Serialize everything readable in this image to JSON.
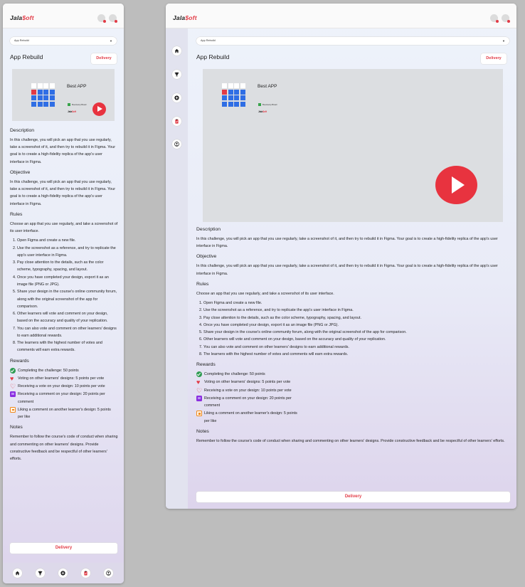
{
  "brand": {
    "logo_main": "Jala",
    "logo_accent": "$oft",
    "accent_color": "#e23a45"
  },
  "header": {
    "icons": [
      "notifications-icon",
      "profile-icon"
    ]
  },
  "select": {
    "value": "App Rebuild"
  },
  "page": {
    "title": "App Rebuild",
    "delivery_button": "Delivery"
  },
  "video": {
    "title": "Best APP",
    "brand_line": "Bootcamp Brasil",
    "brand_logo_main": "Jala",
    "brand_logo_accent": "$oft"
  },
  "sections": {
    "description": {
      "heading": "Description",
      "text": "In this challenge, you will pick an app that you use regularly, take a screenshot of it, and then try to rebuild it in Figma. Your goal is to create a high-fidelity replica of the app's user interface in Figma."
    },
    "objective": {
      "heading": "Objective",
      "text": "In this challenge, you will pick an app that you use regularly, take a screenshot of it, and then try to rebuild it in Figma. Your goal is to create a high-fidelity replica of the app's user interface in Figma."
    },
    "rules": {
      "heading": "Rules",
      "intro": "Choose an app that you use regularly, and take a screenshot of its user interface.",
      "items": [
        "Open Figma and create a new file.",
        "Use the screenshot as a reference, and try to replicate the app's user interface in Figma.",
        "Pay close attention to the details, such as the color scheme, typography, spacing, and layout.",
        "Once you have completed your design, export it as an image file (PNG or JPG).",
        "Share your design in the course's online community forum, along with the original screenshot of the app for comparison.",
        "Other learners will vote and comment on your design, based on the accuracy and quality of your replication.",
        "You can also vote and comment on other learners' designs to earn additional rewards.",
        "The learners with the highest number of votes and comments will earn extra rewards."
      ]
    },
    "rewards": {
      "heading": "Rewards",
      "items": [
        {
          "icon": "check-circle-icon",
          "text": "Completing the challenge: 50 points"
        },
        {
          "icon": "heart-icon",
          "text": "Voting on other learners' designs: 5 points per vote"
        },
        {
          "icon": "heart-outline-icon",
          "text": "Receiving a vote on your design: 10 points per vote"
        },
        {
          "icon": "comment-icon",
          "text": "Receiving a comment on your design: 20 points per comment"
        },
        {
          "icon": "like-icon",
          "text": "Liking a comment on another learner's design: 5 points per like"
        }
      ]
    },
    "notes": {
      "heading": "Notes",
      "text": "Remember to follow the course's code of conduct when sharing and commenting on other learners' designs. Provide constructive feedback and be respectful of other learners' efforts."
    }
  },
  "footer": {
    "delivery_button": "Delivery"
  },
  "nav": [
    "home-icon",
    "trophy-icon",
    "add-circle-icon",
    "clipboard-icon",
    "profile-circle-icon"
  ]
}
